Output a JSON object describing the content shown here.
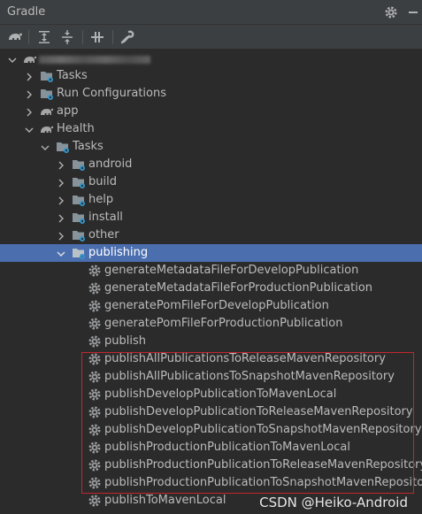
{
  "panel": {
    "title": "Gradle"
  },
  "toolbar": {
    "tools": [
      "gradle-elephant-icon",
      "expand-all-icon",
      "collapse-all-icon",
      "toggle-offline-icon",
      "settings-wrench-icon"
    ]
  },
  "tree": {
    "root": {
      "label": "",
      "icon": "gradle-elephant-icon"
    },
    "tasks": "Tasks",
    "run_configurations": "Run Configurations",
    "app": "app",
    "health": "Health",
    "health_tasks": "Tasks",
    "groups": [
      "android",
      "build",
      "help",
      "install",
      "other",
      "publishing"
    ],
    "publishing_tasks": [
      "generateMetadataFileForDevelopPublication",
      "generateMetadataFileForProductionPublication",
      "generatePomFileForDevelopPublication",
      "generatePomFileForProductionPublication",
      "publish",
      "publishAllPublicationsToReleaseMavenRepository",
      "publishAllPublicationsToSnapshotMavenRepository",
      "publishDevelopPublicationToMavenLocal",
      "publishDevelopPublicationToReleaseMavenRepository",
      "publishDevelopPublicationToSnapshotMavenRepository",
      "publishProductionPublicationToMavenLocal",
      "publishProductionPublicationToReleaseMavenRepository",
      "publishProductionPublicationToSnapshotMavenRepository",
      "publishToMavenLocal"
    ],
    "selected": "publishing"
  },
  "watermark": "CSDN @Heiko-Android",
  "colors": {
    "background": "#2b2b2b",
    "selection": "#4b6eaf",
    "highlight_border": "#c4262e",
    "text": "#bbbbbb"
  }
}
